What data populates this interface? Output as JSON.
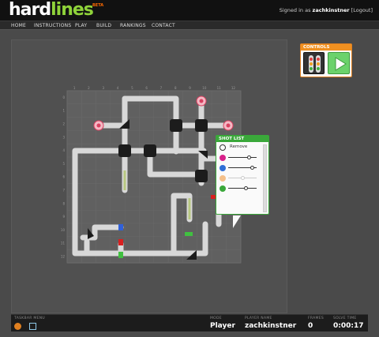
{
  "header": {
    "logo_part1": "hard",
    "logo_part2": "lines",
    "logo_beta": "BETA",
    "signed_in_prefix": "Signed in as",
    "username": "zachkinstner",
    "logout": "[Logout]"
  },
  "nav": {
    "items": [
      "HOME",
      "INSTRUCTIONS",
      "PLAY",
      "BUILD",
      "RANKINGS",
      "CONTACT"
    ]
  },
  "controls": {
    "title": "CONTROLS"
  },
  "shotlist": {
    "title": "SHOT LIST",
    "remove_label": "Remove",
    "shots": [
      {
        "color": "#d8208a"
      },
      {
        "color": "#2f6fd6"
      },
      {
        "color": "#f4c08a"
      },
      {
        "color": "#3aa83a"
      }
    ]
  },
  "grid": {
    "col_labels": [
      "1",
      "2",
      "3",
      "4",
      "5",
      "6",
      "7",
      "8",
      "9",
      "10",
      "11",
      "12"
    ],
    "row_labels": [
      "0",
      "1",
      "2",
      "3",
      "4",
      "5",
      "6",
      "7",
      "8",
      "9",
      "10",
      "11",
      "12"
    ]
  },
  "bottombar": {
    "taskbar_label": "TASKBAR MENU",
    "mode_label": "MODE",
    "mode_value": "Player",
    "player_label": "PLAYER NAME",
    "player_value": "zachkinstner",
    "frames_label": "FRAMES",
    "frames_value": "0",
    "solve_label": "SOLVE TIME",
    "solve_value": "0:00:17"
  },
  "colors": {
    "accent_green": "#8fd33a",
    "controls_orange": "#f09020",
    "shotlist_green": "#3aa83a"
  }
}
